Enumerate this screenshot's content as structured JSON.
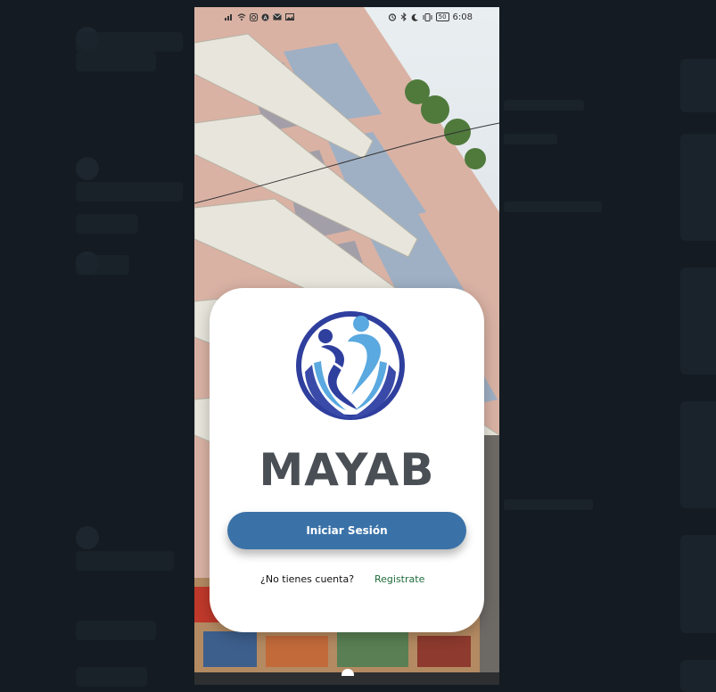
{
  "status_bar": {
    "time": "6:08",
    "battery": "50"
  },
  "login_card": {
    "brand": "MAYAB",
    "login_button": "Iniciar Sesión",
    "no_account_text": "¿No tienes cuenta?",
    "register_link": "Registrate"
  },
  "colors": {
    "button": "#3a72a8",
    "brand_text": "#4a4f55",
    "register_link": "#1f6b3a",
    "logo_dark_blue": "#2f3f9e",
    "logo_light_blue": "#5aa9e0"
  }
}
